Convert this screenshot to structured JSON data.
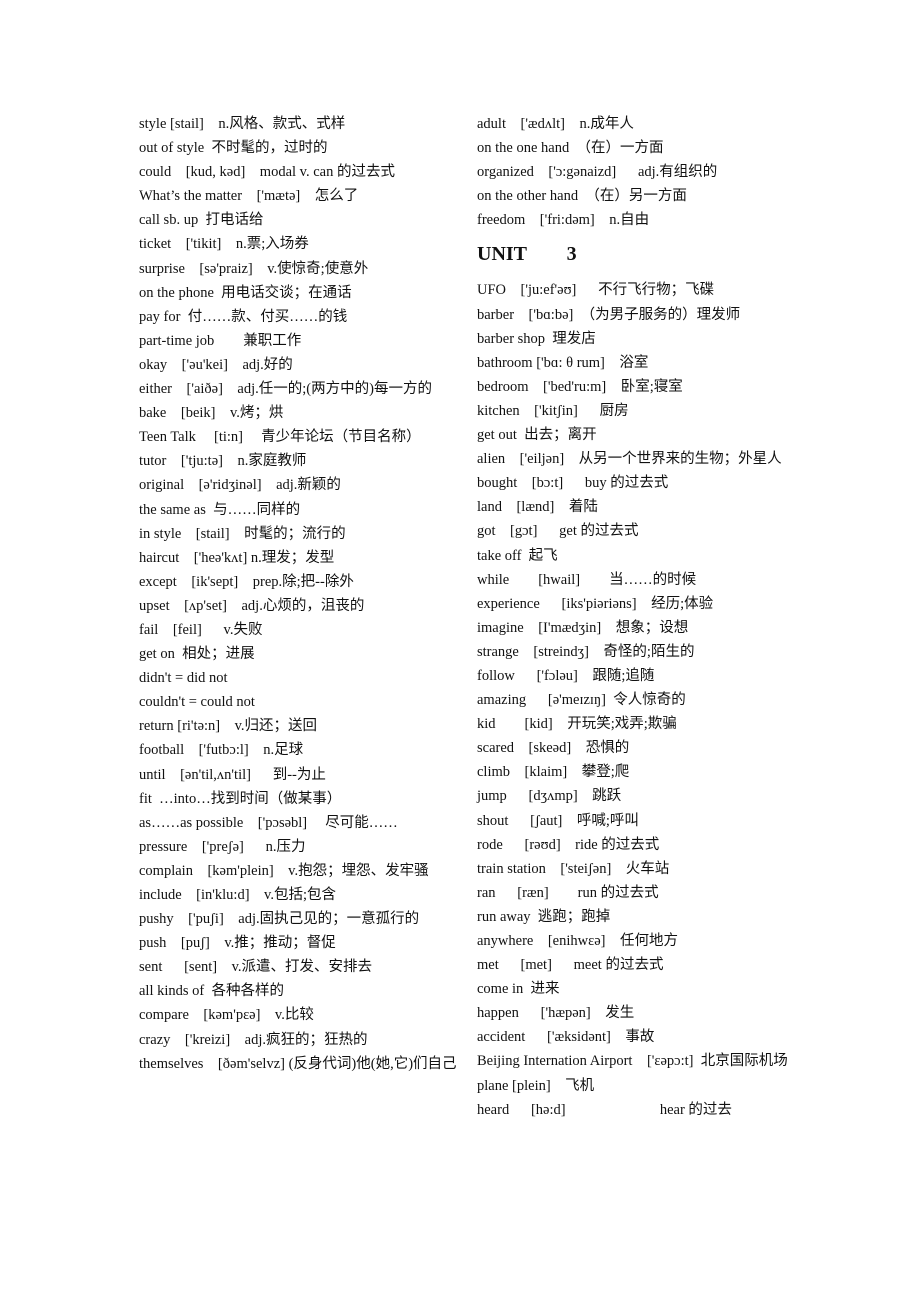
{
  "left_column": {
    "entries": [
      "style [stail]    n.风格、款式、式样",
      "out of style  不时髦的，过时的",
      "could    [kud, kəd]    modal v. can 的过去式",
      "What’s the matter    ['mætə]    怎么了",
      "call sb. up  打电话给",
      "ticket    ['tikit]    n.票;入场券",
      "surprise    [sə'praiz]    v.使惊奇;使意外",
      "on the phone  用电话交谈；在通话",
      "pay for  付……款、付买……的钱",
      "part-time job        兼职工作",
      "okay    ['əu'kei]    adj.好的",
      "either    ['aiðə]    adj.任一的;(两方中的)每一方的",
      "bake    [beik]    v.烤；烘",
      "Teen Talk     [ti:n]     青少年论坛（节目名称）",
      "tutor    ['tju:tə]    n.家庭教师",
      "original    [ə'ridʒinəl]    adj.新颖的",
      "the same as  与……同样的",
      "in style    [stail]    时髦的；流行的",
      "haircut    ['heə'kʌt] n.理发；发型",
      "except    [ik'sept]    prep.除;把--除外",
      "upset    [ʌp'set]    adj.心烦的，沮丧的",
      "fail    [feil]      v.失败",
      "get on  相处；进展",
      "didn't = did not",
      "couldn't = could not",
      "return [ri'tə:n]    v.归还；送回",
      "football    ['futbɔ:l]    n.足球",
      "until    [ən'til,ʌn'til]      到--为止",
      "fit  …into…找到时间（做某事）",
      "as……as possible    ['pɔsəbl]     尽可能……",
      "pressure    ['preʃə]      n.压力",
      "complain    [kəm'plein]    v.抱怨；埋怨、发牢骚",
      "include    [in'klu:d]    v.包括;包含",
      "pushy    ['puʃi]    adj.固执己见的；一意孤行的",
      "push    [puʃ]    v.推；推动；督促",
      "sent      [sent]    v.派遣、打发、安排去",
      "all kinds of  各种各样的",
      "compare    [kəm'pεə]    v.比较",
      "crazy    ['kreizi]    adj.疯狂的；狂热的",
      "themselves    [ðəm'selvz] (反身代词)他(她,它)们自己"
    ]
  },
  "right_column": {
    "entries_before_heading": [
      "adult    ['ædʌlt]    n.成年人",
      "on the one hand  （在）一方面",
      "organized    ['ɔ:gənaizd]      adj.有组织的",
      "on the other hand  （在）另一方面",
      "freedom    ['fri:dəm]    n.自由"
    ],
    "unit_heading": "UNIT        3",
    "entries_after_heading": [
      "UFO    ['ju:ef'əʊ]      不行飞行物；飞碟",
      "barber    ['bɑ:bə]  （为男子服务的）理发师",
      "barber shop  理发店",
      "bathroom ['bɑ: θ rum]    浴室",
      "bedroom    ['bed'ru:m]    卧室;寝室",
      "kitchen    ['kitʃin]      厨房",
      "get out  出去；离开",
      "alien    ['eiljən]    从另一个世界来的生物；外星人",
      "bought    [bɔ:t]      buy 的过去式",
      "land    [lænd]    着陆",
      "got    [gɔt]      get 的过去式",
      "take off  起飞",
      "while        [hwail]        当……的时候",
      "experience      [iks'piəriəns]    经历;体验",
      "imagine    [I'mædʒin]    想象；设想",
      "strange    [streindʒ]    奇怪的;陌生的",
      "follow      ['fɔləu]    跟随;追随",
      "amazing      [ə'meɪzɪŋ]  令人惊奇的",
      "kid        [kid]    开玩笑;戏弄;欺骗",
      "scared    [skeəd]    恐惧的",
      "climb    [klaim]    攀登;爬",
      "jump      [dʒʌmp]    跳跃",
      "shout      [ʃaut]    呼喊;呼叫",
      "rode      [rəʊd]    ride 的过去式",
      "train station    ['steiʃən]    火车站",
      "ran      [ræn]        run 的过去式",
      "run away  逃跑；跑掉",
      "anywhere    [enihwεə]    任何地方",
      "met      [met]      meet 的过去式",
      "come in  进来",
      "happen      ['hæpən]    发生",
      "accident      ['æksidənt]    事故",
      "Beijing Internation Airport    ['εəpɔ:t]  北京国际机场",
      "plane [plein]    飞机",
      "heard      [hə:d]                          hear 的过去"
    ]
  }
}
